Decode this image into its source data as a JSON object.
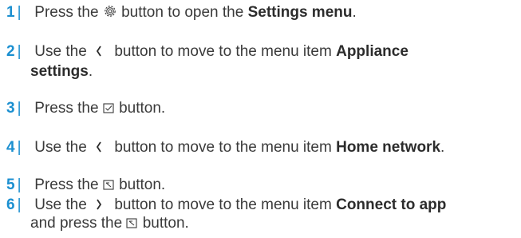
{
  "steps": [
    {
      "number": "1",
      "sep": "|",
      "parts": [
        "Press the",
        "button to open the",
        "Settings menu",
        "."
      ]
    },
    {
      "number": "2",
      "sep": "|",
      "parts": [
        "Use the",
        "button to move to the menu item",
        "Appliance",
        "settings",
        "."
      ],
      "chevron": "〈"
    },
    {
      "number": "3",
      "sep": "|",
      "parts": [
        "Press the",
        "button."
      ]
    },
    {
      "number": "4",
      "sep": "|",
      "parts": [
        "Use the",
        "button to move to the menu item",
        "Home network",
        "."
      ],
      "chevron": "〈"
    },
    {
      "number": "5",
      "sep": "|",
      "parts": [
        "Press the",
        "button."
      ]
    },
    {
      "number": "6",
      "sep": "|",
      "parts": [
        "Use the",
        "button to move to the menu item",
        "Connect to app",
        "and press the",
        "button."
      ],
      "chevron": "〉"
    }
  ],
  "icons": {
    "step1": "gear-icon",
    "step2": "chevron-left-icon",
    "step3": "checkbox-icon",
    "step4": "chevron-left-icon",
    "step5": "confirm-icon",
    "step6_a": "chevron-right-icon",
    "step6_b": "confirm-icon"
  },
  "colors": {
    "step_number": "#1b8fd0",
    "text": "#3a3a3a"
  }
}
